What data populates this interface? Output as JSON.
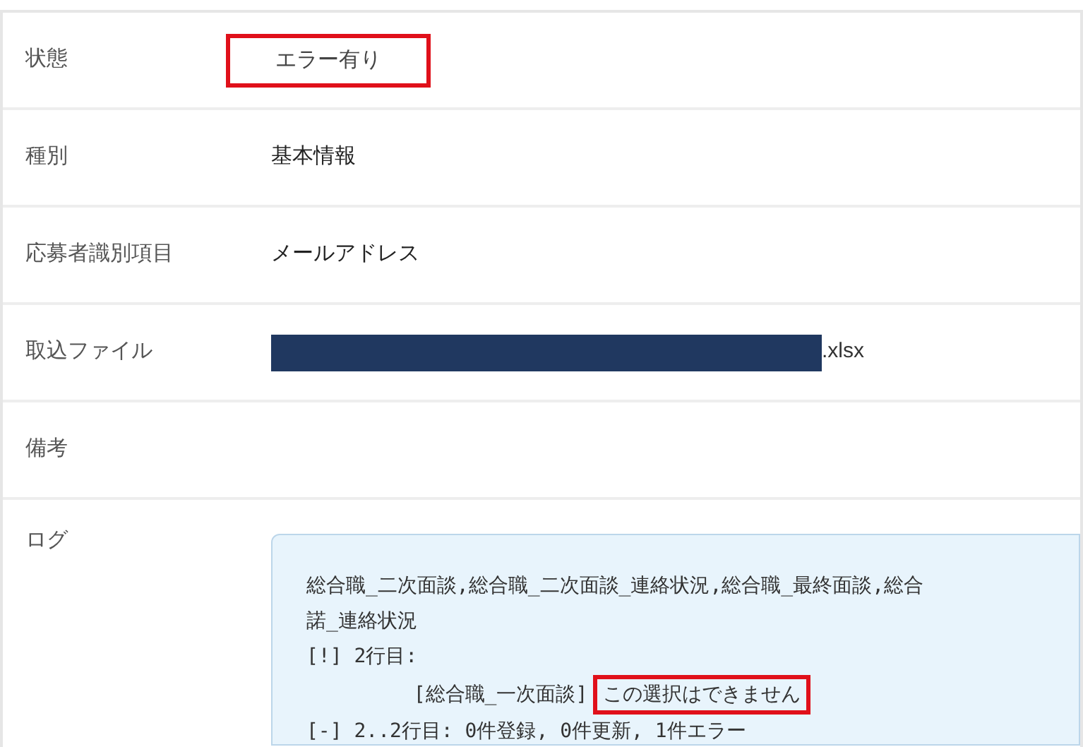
{
  "rows": [
    {
      "kind": "text",
      "label": "状態",
      "value": "エラー有り",
      "highlighted": true
    },
    {
      "kind": "text",
      "label": "種別",
      "value": "基本情報",
      "highlighted": false
    },
    {
      "kind": "text",
      "label": "応募者識別項目",
      "value": "メールアドレス",
      "highlighted": false
    },
    {
      "kind": "file",
      "label": "取込ファイル",
      "value": ".xlsx"
    },
    {
      "kind": "text",
      "label": "備考"
    },
    {
      "kind": "log",
      "label": "ログ",
      "lines": [
        {
          "parts": [
            {
              "text": "総合職_二次面談,総合職_二次面談_連絡状況,総合職_最終面談,総合",
              "highlighted": false
            }
          ]
        },
        {
          "parts": [
            {
              "text": "諾_連絡状況",
              "highlighted": false
            }
          ]
        },
        {
          "parts": [
            {
              "text": "[!] 2行目:",
              "highlighted": false
            }
          ]
        },
        {
          "parts": [
            {
              "text": "         [総合職_一次面談]",
              "highlighted": false
            },
            {
              "text": "この選択はできません",
              "highlighted": true
            }
          ]
        },
        {
          "parts": [
            {
              "text": "[-] 2..2行目: 0件登録, 0件更新, 1件エラー",
              "highlighted": false
            }
          ]
        }
      ]
    }
  ]
}
